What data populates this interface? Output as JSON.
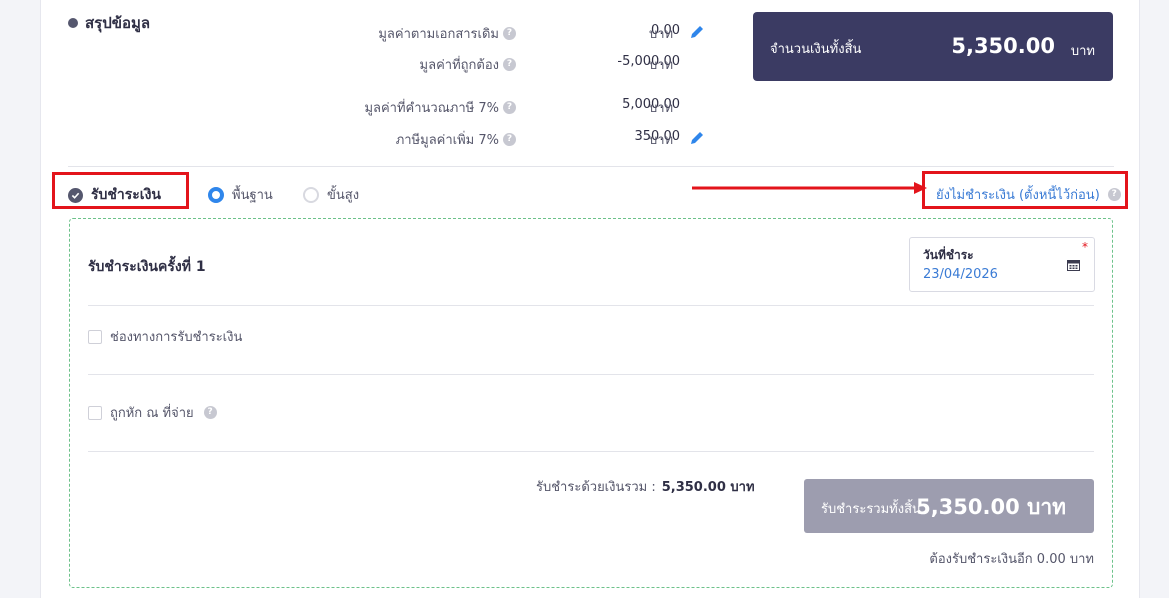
{
  "summary": {
    "title": "สรุปข้อมูล",
    "rows": [
      {
        "label": "มูลค่าตามเอกสารเดิม",
        "value": "0.00",
        "unit": "บาท",
        "editable": true
      },
      {
        "label": "มูลค่าที่ถูกต้อง",
        "value": "-5,000.00",
        "unit": "บาท",
        "editable": false
      },
      {
        "label": "มูลค่าที่คำนวณภาษี 7%",
        "value": "5,000.00",
        "unit": "บาท",
        "editable": false
      },
      {
        "label": "ภาษีมูลค่าเพิ่ม 7%",
        "value": "350.00",
        "unit": "บาท",
        "editable": true
      }
    ],
    "total": {
      "label": "จำนวนเงินทั้งสิ้น",
      "value": "5,350.00",
      "unit": "บาท"
    }
  },
  "payment": {
    "title": "รับชำระเงิน",
    "mode_basic": "พื้นฐาน",
    "mode_advanced": "ขั้นสูง",
    "selected_mode": "basic",
    "unpaid_link": "ยังไม่ชำระเงิน (ตั้งหนี้ไว้ก่อน)",
    "installment_title": "รับชำระเงินครั้งที่ 1",
    "date_label": "วันที่ชำระ",
    "date_required": "*",
    "date_value": "23/04/2026",
    "channel_label": "ช่องทางการรับชำระเงิน",
    "withholding_label": "ถูกหัก ณ ที่จ่าย",
    "cash_sum_label": "รับชำระด้วยเงินรวม :",
    "cash_sum_value": "5,350.00 บาท",
    "grand_label": "รับชำระรวมทั้งสิ้น",
    "grand_value": "5,350.00 บาท",
    "remaining": "ต้องรับชำระเงินอีก 0.00 บาท"
  },
  "colors": {
    "accent": "#3a7bd5",
    "dark_box": "#3b3b63",
    "highlight": "#e3141b",
    "panel_border": "#6cc28a"
  }
}
